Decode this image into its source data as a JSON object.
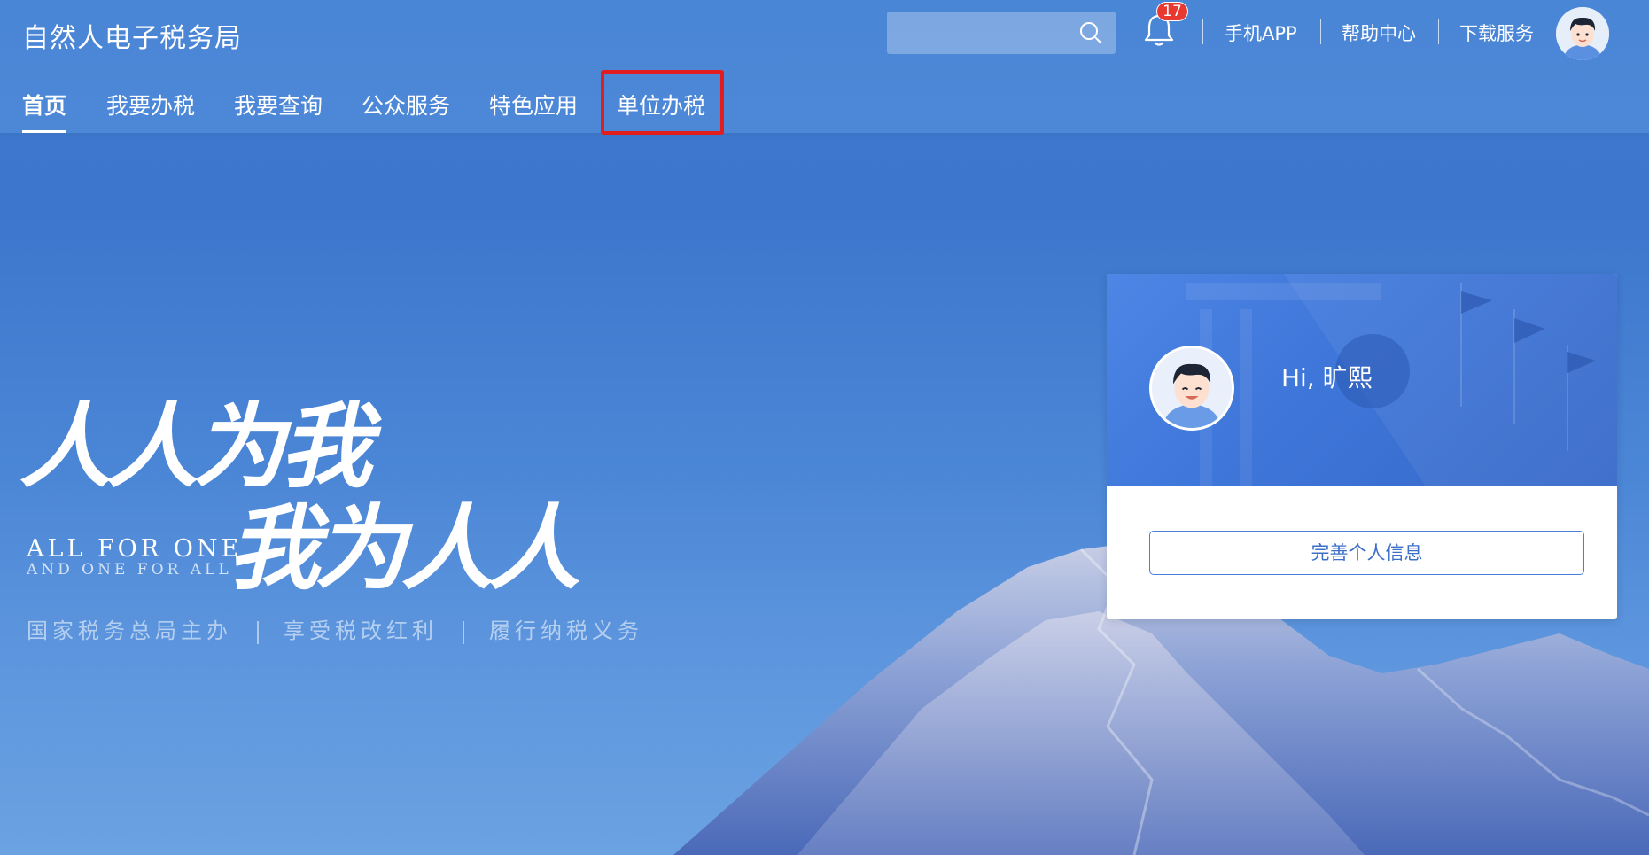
{
  "header": {
    "site_title": "自然人电子税务局",
    "search_placeholder": "",
    "notification_count": "17",
    "links": [
      "手机APP",
      "帮助中心",
      "下载服务"
    ]
  },
  "nav": {
    "items": [
      "首页",
      "我要办税",
      "我要查询",
      "公众服务",
      "特色应用",
      "单位办税"
    ],
    "active_index": 0,
    "highlighted_index": 5
  },
  "hero": {
    "calligraphy": "人人为我 我为人人",
    "slogan_line1": "ALL FOR ONE",
    "slogan_line2": "AND ONE FOR ALL",
    "tagline": [
      "国家税务总局主办",
      "享受税改红利",
      "履行纳税义务"
    ]
  },
  "profile_card": {
    "greeting": "Hi, 旷熙",
    "button_label": "完善个人信息"
  },
  "colors": {
    "accent": "#4a7fd8",
    "highlight_border": "#e21d1d",
    "badge": "#e8382f"
  },
  "icons": {
    "search": "search-icon",
    "notification": "bell-icon",
    "avatar": "user-avatar"
  }
}
